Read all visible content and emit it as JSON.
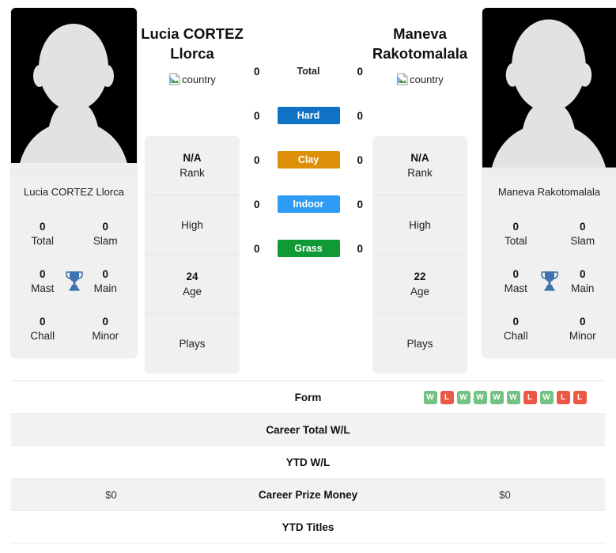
{
  "players": {
    "left": {
      "headline_name": "Lucia CORTEZ Llorca",
      "caption_name": "Lucia CORTEZ Llorca",
      "country_alt": "country",
      "titles": [
        {
          "value": "0",
          "label": "Total"
        },
        {
          "value": "0",
          "label": "Slam"
        },
        {
          "value": "0",
          "label": "Mast"
        },
        {
          "value": "0",
          "label": "Main"
        },
        {
          "value": "0",
          "label": "Chall"
        },
        {
          "value": "0",
          "label": "Minor"
        }
      ],
      "info": [
        {
          "value": "N/A",
          "label": "Rank"
        },
        {
          "value": "",
          "label": "High"
        },
        {
          "value": "24",
          "label": "Age"
        },
        {
          "value": "",
          "label": "Plays"
        }
      ]
    },
    "right": {
      "headline_name": "Maneva Rakotomalala",
      "caption_name": "Maneva Rakotomalala",
      "country_alt": "country",
      "titles": [
        {
          "value": "0",
          "label": "Total"
        },
        {
          "value": "0",
          "label": "Slam"
        },
        {
          "value": "0",
          "label": "Mast"
        },
        {
          "value": "0",
          "label": "Main"
        },
        {
          "value": "0",
          "label": "Chall"
        },
        {
          "value": "0",
          "label": "Minor"
        }
      ],
      "info": [
        {
          "value": "N/A",
          "label": "Rank"
        },
        {
          "value": "",
          "label": "High"
        },
        {
          "value": "22",
          "label": "Age"
        },
        {
          "value": "",
          "label": "Plays"
        }
      ]
    }
  },
  "surfaces": [
    {
      "label": "Total",
      "left_score": "0",
      "right_score": "0",
      "color": "transparent"
    },
    {
      "label": "Hard",
      "left_score": "0",
      "right_score": "0",
      "color": "#0f72c4"
    },
    {
      "label": "Clay",
      "left_score": "0",
      "right_score": "0",
      "color": "#dd8f08"
    },
    {
      "label": "Indoor",
      "left_score": "0",
      "right_score": "0",
      "color": "#2e9cf5"
    },
    {
      "label": "Grass",
      "left_score": "0",
      "right_score": "0",
      "color": "#0f9a35"
    }
  ],
  "stats_table": [
    {
      "label": "Form",
      "left": "",
      "right": "",
      "right_badges": [
        "W",
        "L",
        "W",
        "W",
        "W",
        "W",
        "L",
        "W",
        "L",
        "L"
      ]
    },
    {
      "label": "Career Total W/L",
      "left": "",
      "right": ""
    },
    {
      "label": "YTD W/L",
      "left": "",
      "right": ""
    },
    {
      "label": "Career Prize Money",
      "left": "$0",
      "right": "$0"
    },
    {
      "label": "YTD Titles",
      "left": "",
      "right": ""
    }
  ],
  "colors": {
    "win_badge": "#73c183",
    "loss_badge": "#eb5844",
    "trophy": "#3f72b0",
    "card_bg": "#f0f0f0",
    "row_alt": "#f2f2f2"
  }
}
